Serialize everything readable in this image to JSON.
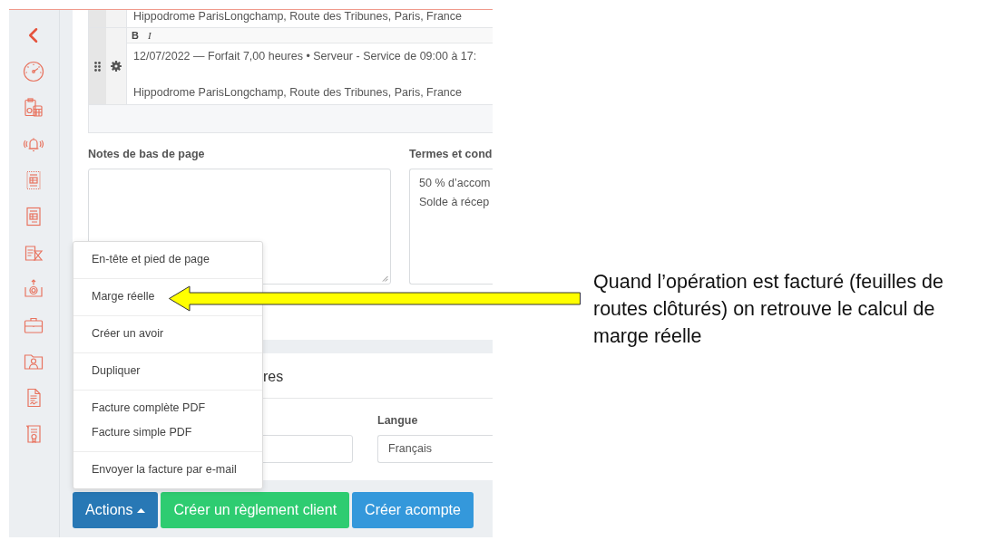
{
  "line_items": [
    {
      "cut_off": true,
      "lines": [
        "Hippodrome ParisLongchamp, Route des Tribunes, Paris, France"
      ]
    },
    {
      "cut_off": false,
      "toolbar": [
        {
          "label": "B",
          "kind": "bold"
        },
        {
          "label": "I",
          "kind": "italic"
        }
      ],
      "lines": [
        "12/07/2022 — Forfait 7,00 heures • Serveur - Service de 09:00 à 17:",
        "Hippodrome ParisLongchamp, Route des Tribunes, Paris, France"
      ]
    }
  ],
  "footer_notes": {
    "label": "Notes de bas de page"
  },
  "terms": {
    "label": "Termes et cond",
    "value": "50 % d’accom\nSolde à récep"
  },
  "section": {
    "heading": "res",
    "fields": [
      {
        "kind": "input"
      },
      {
        "kind": "select",
        "label": "Langue",
        "value": "Français"
      }
    ]
  },
  "actions_menu": {
    "groups": [
      [
        "En-tête et pied de page"
      ],
      [
        "Marge réelle"
      ],
      [
        "Créer un avoir"
      ],
      [
        "Dupliquer"
      ],
      [
        "Facture complète PDF",
        "Facture simple PDF"
      ],
      [
        "Envoyer la facture par e-mail"
      ]
    ]
  },
  "buttons": [
    {
      "label": "Actions",
      "kind": "dropdown",
      "expanded": true,
      "color": "#2878b5"
    },
    {
      "label": "Créer un règlement client",
      "kind": "plain",
      "color": "#2ecc71"
    },
    {
      "label": "Créer acompte",
      "kind": "plain",
      "color": "#3498db"
    }
  ],
  "annotation": {
    "text": "Quand l’opération est facturé (feuilles de routes clôturés) on retrouve le calcul de marge réelle"
  }
}
